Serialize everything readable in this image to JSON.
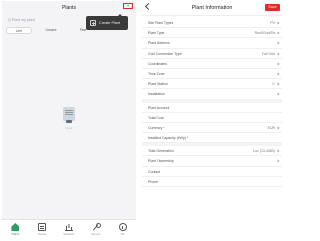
{
  "left": {
    "title": "Plants",
    "add_label": "+",
    "search_placeholder": "Q Plant my plant",
    "tabs": [
      "Unit",
      "Uncare",
      "Fine"
    ],
    "menu_item": "Create Plant",
    "empty_text": "None",
    "nav": [
      {
        "label": "Plants",
        "icon": "home-icon",
        "active": true
      },
      {
        "label": "Tickets",
        "icon": "tickets-icon",
        "active": false
      },
      {
        "label": "Statistics",
        "icon": "stats-icon",
        "active": false
      },
      {
        "label": "Service",
        "icon": "service-icon",
        "active": false
      },
      {
        "label": "Me",
        "icon": "me-icon",
        "active": false
      }
    ]
  },
  "right": {
    "title": "Plant Information",
    "save_label": "Save",
    "rows_a": [
      {
        "label": "Site Plant Types",
        "value": "PV"
      },
      {
        "label": "Plant Type",
        "value": "Roof/Grid/Str"
      },
      {
        "label": "Plant Address",
        "value": ""
      },
      {
        "label": "Grid Connection Type",
        "value": "Full Grid"
      },
      {
        "label": "Coordinates",
        "value": ""
      },
      {
        "label": "Time Zone",
        "value": ""
      },
      {
        "label": "Plant Station",
        "value": "C"
      },
      {
        "label": "Installation",
        "value": ""
      }
    ],
    "rows_b": [
      {
        "label": "Plant Account",
        "value": ""
      },
      {
        "label": "Total Cost",
        "value": ""
      },
      {
        "label": "Currency",
        "value": "EUR",
        "required": true
      },
      {
        "label": "Installed Capacity (kWp)",
        "value": "",
        "required": true
      }
    ],
    "rows_c": [
      {
        "label": "Total Generation",
        "value": "Loc (13-4083)"
      },
      {
        "label": "Plant Ownership",
        "value": ""
      },
      {
        "label": "Contact",
        "value": ""
      },
      {
        "label": "Phone",
        "value": ""
      }
    ]
  },
  "colors": {
    "accent_red": "#e32b2b",
    "nav_green": "#2e9b5f"
  }
}
